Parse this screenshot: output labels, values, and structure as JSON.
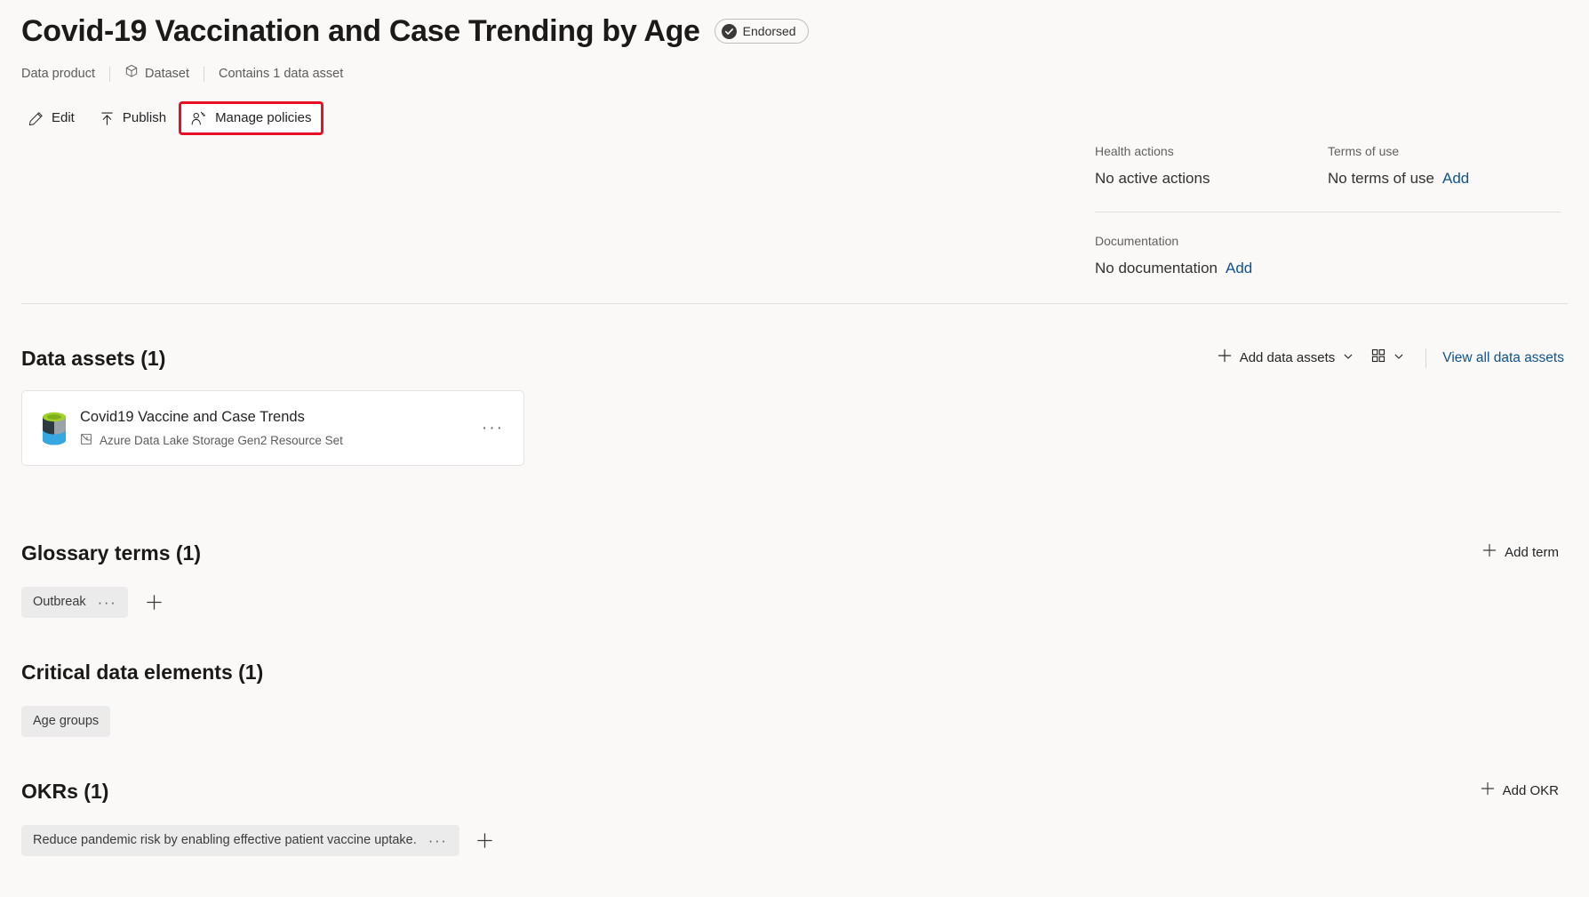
{
  "header": {
    "title": "Covid-19 Vaccination and Case Trending by Age",
    "endorsed_label": "Endorsed",
    "breadcrumb": {
      "data_product": "Data product",
      "dataset": "Dataset",
      "contains": "Contains 1 data asset"
    },
    "commands": {
      "edit": "Edit",
      "publish": "Publish",
      "manage_policies": "Manage policies"
    },
    "highlight_color": "#e81123"
  },
  "meta": {
    "health_actions_label": "Health actions",
    "health_actions_value": "No active actions",
    "terms_of_use_label": "Terms of use",
    "terms_of_use_value": "No terms of use",
    "terms_of_use_add": "Add",
    "documentation_label": "Documentation",
    "documentation_value": "No documentation",
    "documentation_add": "Add"
  },
  "data_assets": {
    "title": "Data assets (1)",
    "add_button": "Add data assets",
    "view_all_link": "View all data assets",
    "items": [
      {
        "name": "Covid19 Vaccine and Case Trends",
        "type": "Azure Data Lake Storage Gen2 Resource Set",
        "more": "···"
      }
    ]
  },
  "glossary_terms": {
    "title": "Glossary terms (1)",
    "add_button": "Add term",
    "chips": [
      {
        "label": "Outbreak",
        "more": "···"
      }
    ]
  },
  "critical_data_elements": {
    "title": "Critical data elements (1)",
    "chips": [
      {
        "label": "Age groups"
      }
    ]
  },
  "okrs": {
    "title": "OKRs (1)",
    "add_button": "Add OKR",
    "chips": [
      {
        "label": "Reduce pandemic risk by enabling effective patient vaccine uptake.",
        "more": "···"
      }
    ]
  },
  "colors": {
    "accent_link": "#0f548c",
    "highlight": "#e81123",
    "background": "#faf9f8"
  }
}
